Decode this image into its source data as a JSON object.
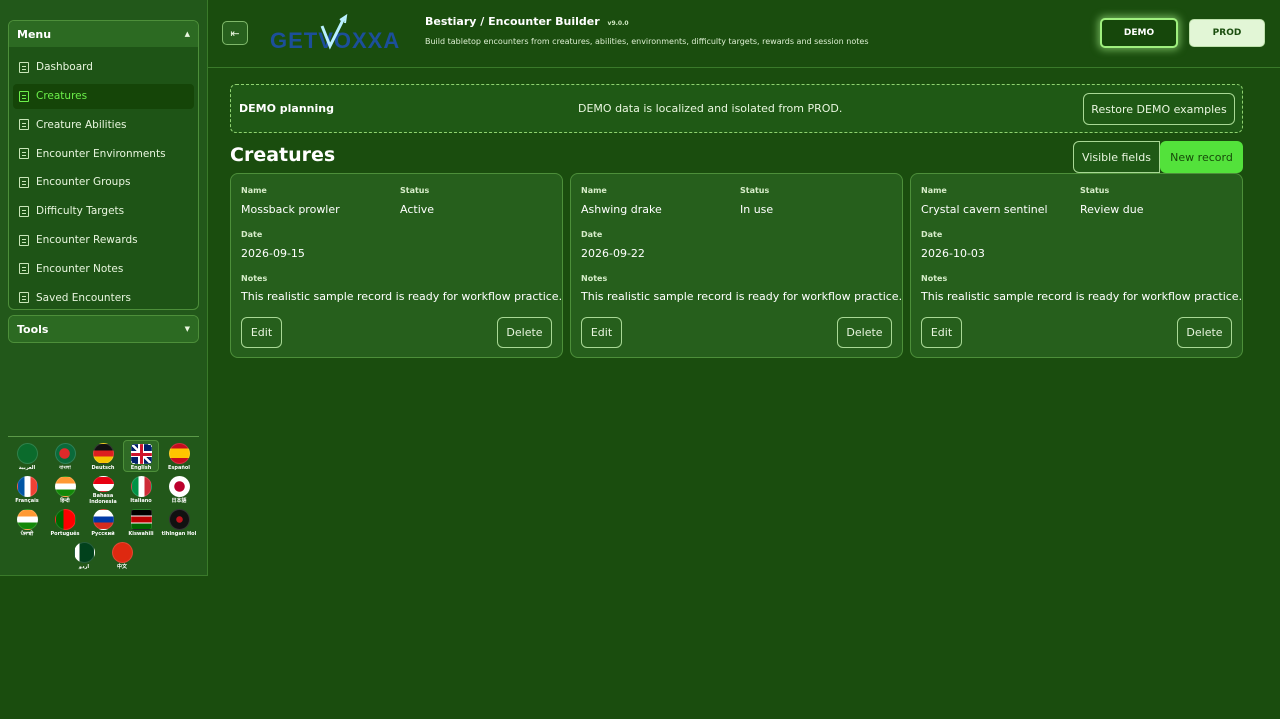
{
  "sidebar": {
    "menu_title": "Menu",
    "tools_title": "Tools",
    "items": [
      {
        "label": "Dashboard"
      },
      {
        "label": "Creatures"
      },
      {
        "label": "Creature Abilities"
      },
      {
        "label": "Encounter Environments"
      },
      {
        "label": "Encounter Groups"
      },
      {
        "label": "Difficulty Targets"
      },
      {
        "label": "Encounter Rewards"
      },
      {
        "label": "Encounter Notes"
      },
      {
        "label": "Saved Encounters"
      }
    ],
    "active_item": "Creatures",
    "languages": [
      {
        "label": "العربية"
      },
      {
        "label": "বাংলা"
      },
      {
        "label": "Deutsch"
      },
      {
        "label": "English",
        "selected": true
      },
      {
        "label": "Español"
      },
      {
        "label": "Français"
      },
      {
        "label": "हिन्दी"
      },
      {
        "label": "Bahasa Indonesia"
      },
      {
        "label": "Italiano"
      },
      {
        "label": "日本語"
      },
      {
        "label": "ਪੰਜਾਬੀ"
      },
      {
        "label": "Português"
      },
      {
        "label": "Русский"
      },
      {
        "label": "Kiswahili"
      },
      {
        "label": "tlhIngan Hol"
      },
      {
        "label": "اردو"
      },
      {
        "label": "中文"
      }
    ]
  },
  "header": {
    "logo_text": "GETVOXXA",
    "title": "Bestiary / Encounter Builder",
    "version": "v9.0.0",
    "subtitle": "Build tabletop encounters from creatures, abilities, environments, difficulty targets, rewards and session notes",
    "demo_label": "DEMO",
    "prod_label": "PROD",
    "active_env": "DEMO"
  },
  "notice": {
    "title": "DEMO planning",
    "text": "DEMO data is localized and isolated from PROD.",
    "restore_label": "Restore DEMO examples"
  },
  "section": {
    "title": "Creatures",
    "visible_fields_label": "Visible fields",
    "new_record_label": "New record"
  },
  "labels": {
    "name": "Name",
    "status": "Status",
    "date": "Date",
    "notes": "Notes",
    "edit": "Edit",
    "delete": "Delete"
  },
  "records": [
    {
      "name": "Mossback prowler",
      "status": "Active",
      "date": "2026-09-15",
      "notes": "This realistic sample record is ready for workflow practice."
    },
    {
      "name": "Ashwing drake",
      "status": "In use",
      "date": "2026-09-22",
      "notes": "This realistic sample record is ready for workflow practice."
    },
    {
      "name": "Crystal cavern sentinel",
      "status": "Review due",
      "date": "2026-10-03",
      "notes": "This realistic sample record is ready for workflow practice."
    }
  ],
  "colors": {
    "background": "#1a4d0e",
    "accent": "#53e23b",
    "active_text": "#6cf04a"
  }
}
